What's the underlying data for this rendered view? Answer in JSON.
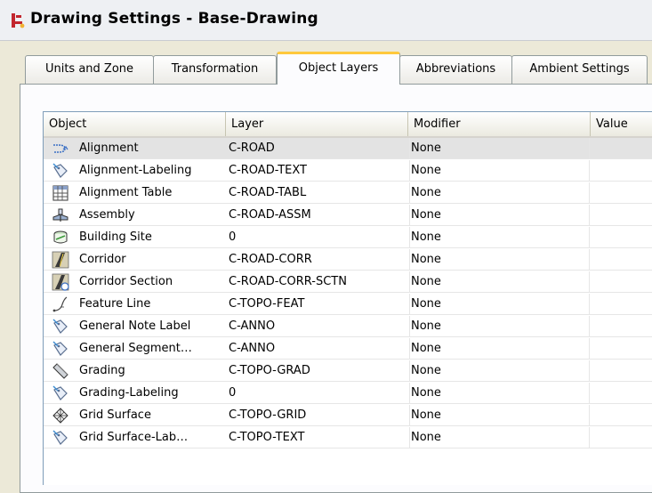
{
  "window": {
    "title": "Drawing Settings - Base-Drawing"
  },
  "tabs": [
    {
      "label": "Units and Zone",
      "active": false
    },
    {
      "label": "Transformation",
      "active": false
    },
    {
      "label": "Object Layers",
      "active": true
    },
    {
      "label": "Abbreviations",
      "active": false
    },
    {
      "label": "Ambient Settings",
      "active": false
    }
  ],
  "table": {
    "columns": [
      "Object",
      "Layer",
      "Modifier",
      "Value"
    ],
    "rows": [
      {
        "icon": "alignment-icon",
        "object": "Alignment",
        "layer": "C-ROAD",
        "modifier": "None",
        "value": "",
        "selected": true
      },
      {
        "icon": "label-icon",
        "object": "Alignment-Labeling",
        "layer": "C-ROAD-TEXT",
        "modifier": "None",
        "value": ""
      },
      {
        "icon": "table-icon",
        "object": "Alignment Table",
        "layer": "C-ROAD-TABL",
        "modifier": "None",
        "value": ""
      },
      {
        "icon": "assembly-icon",
        "object": "Assembly",
        "layer": "C-ROAD-ASSM",
        "modifier": "None",
        "value": ""
      },
      {
        "icon": "building-site-icon",
        "object": "Building Site",
        "layer": "0",
        "modifier": "None",
        "value": ""
      },
      {
        "icon": "corridor-icon",
        "object": "Corridor",
        "layer": "C-ROAD-CORR",
        "modifier": "None",
        "value": ""
      },
      {
        "icon": "corridor-section-icon",
        "object": "Corridor Section",
        "layer": "C-ROAD-CORR-SCTN",
        "modifier": "None",
        "value": ""
      },
      {
        "icon": "feature-line-icon",
        "object": "Feature Line",
        "layer": "C-TOPO-FEAT",
        "modifier": "None",
        "value": ""
      },
      {
        "icon": "label-icon",
        "object": "General Note Label",
        "layer": "C-ANNO",
        "modifier": "None",
        "value": ""
      },
      {
        "icon": "label-icon",
        "object": "General Segment…",
        "layer": "C-ANNO",
        "modifier": "None",
        "value": ""
      },
      {
        "icon": "grading-icon",
        "object": "Grading",
        "layer": "C-TOPO-GRAD",
        "modifier": "None",
        "value": ""
      },
      {
        "icon": "label-icon",
        "object": "Grading-Labeling",
        "layer": "0",
        "modifier": "None",
        "value": ""
      },
      {
        "icon": "grid-surface-icon",
        "object": "Grid Surface",
        "layer": "C-TOPO-GRID",
        "modifier": "None",
        "value": ""
      },
      {
        "icon": "label-icon",
        "object": "Grid Surface-Lab…",
        "layer": "C-TOPO-TEXT",
        "modifier": "None",
        "value": ""
      }
    ]
  },
  "colors": {
    "accent_tab": "#ffc83c",
    "selected_row": "#e3e3e3"
  }
}
